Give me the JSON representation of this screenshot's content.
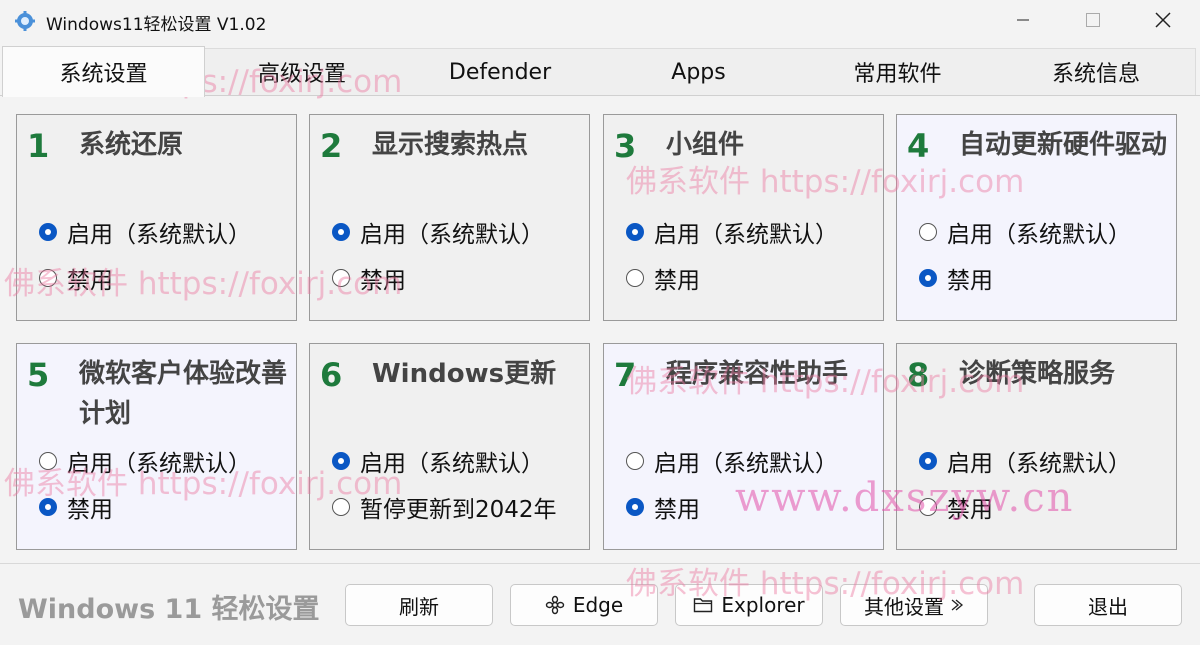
{
  "window": {
    "title": "Windows11轻松设置 V1.02"
  },
  "tabs": [
    {
      "label": "系统设置",
      "active": true
    },
    {
      "label": "高级设置",
      "active": false
    },
    {
      "label": "Defender",
      "active": false
    },
    {
      "label": "Apps",
      "active": false
    },
    {
      "label": "常用软件",
      "active": false
    },
    {
      "label": "系统信息",
      "active": false
    }
  ],
  "cards": [
    {
      "num": "1",
      "title": "系统还原",
      "options": [
        {
          "label": "启用（系统默认）",
          "checked": true
        },
        {
          "label": "禁用",
          "checked": false
        }
      ]
    },
    {
      "num": "2",
      "title": "显示搜索热点",
      "options": [
        {
          "label": "启用（系统默认）",
          "checked": true
        },
        {
          "label": "禁用",
          "checked": false
        }
      ]
    },
    {
      "num": "3",
      "title": "小组件",
      "options": [
        {
          "label": "启用（系统默认）",
          "checked": true
        },
        {
          "label": "禁用",
          "checked": false
        }
      ]
    },
    {
      "num": "4",
      "title": "自动更新硬件驱动",
      "options": [
        {
          "label": "启用（系统默认）",
          "checked": false
        },
        {
          "label": "禁用",
          "checked": true
        }
      ]
    },
    {
      "num": "5",
      "title": "微软客户体验改善计划",
      "options": [
        {
          "label": "启用（系统默认）",
          "checked": false
        },
        {
          "label": "禁用",
          "checked": true
        }
      ]
    },
    {
      "num": "6",
      "title": "Windows更新",
      "options": [
        {
          "label": "启用（系统默认）",
          "checked": true
        },
        {
          "label": "暂停更新到2042年",
          "checked": false
        }
      ]
    },
    {
      "num": "7",
      "title": "程序兼容性助手",
      "options": [
        {
          "label": "启用（系统默认）",
          "checked": false
        },
        {
          "label": "禁用",
          "checked": true
        }
      ]
    },
    {
      "num": "8",
      "title": "诊断策略服务",
      "options": [
        {
          "label": "启用（系统默认）",
          "checked": true
        },
        {
          "label": "禁用",
          "checked": false
        }
      ]
    }
  ],
  "footer": {
    "brand": "Windows 11 轻松设置",
    "buttons": {
      "refresh": "刷新",
      "edge": "Edge",
      "explorer": "Explorer",
      "other": "其他设置",
      "exit": "退出"
    }
  },
  "watermarks": {
    "site": "佛系软件 https://foxirj.com",
    "site_partial": "佛系软件 https://foxirj.com",
    "dx": "www.dxszyw.cn"
  },
  "colors": {
    "accent_radio": "#0a57c4",
    "card_number": "#1e7a3c",
    "card_title": "#444444"
  }
}
